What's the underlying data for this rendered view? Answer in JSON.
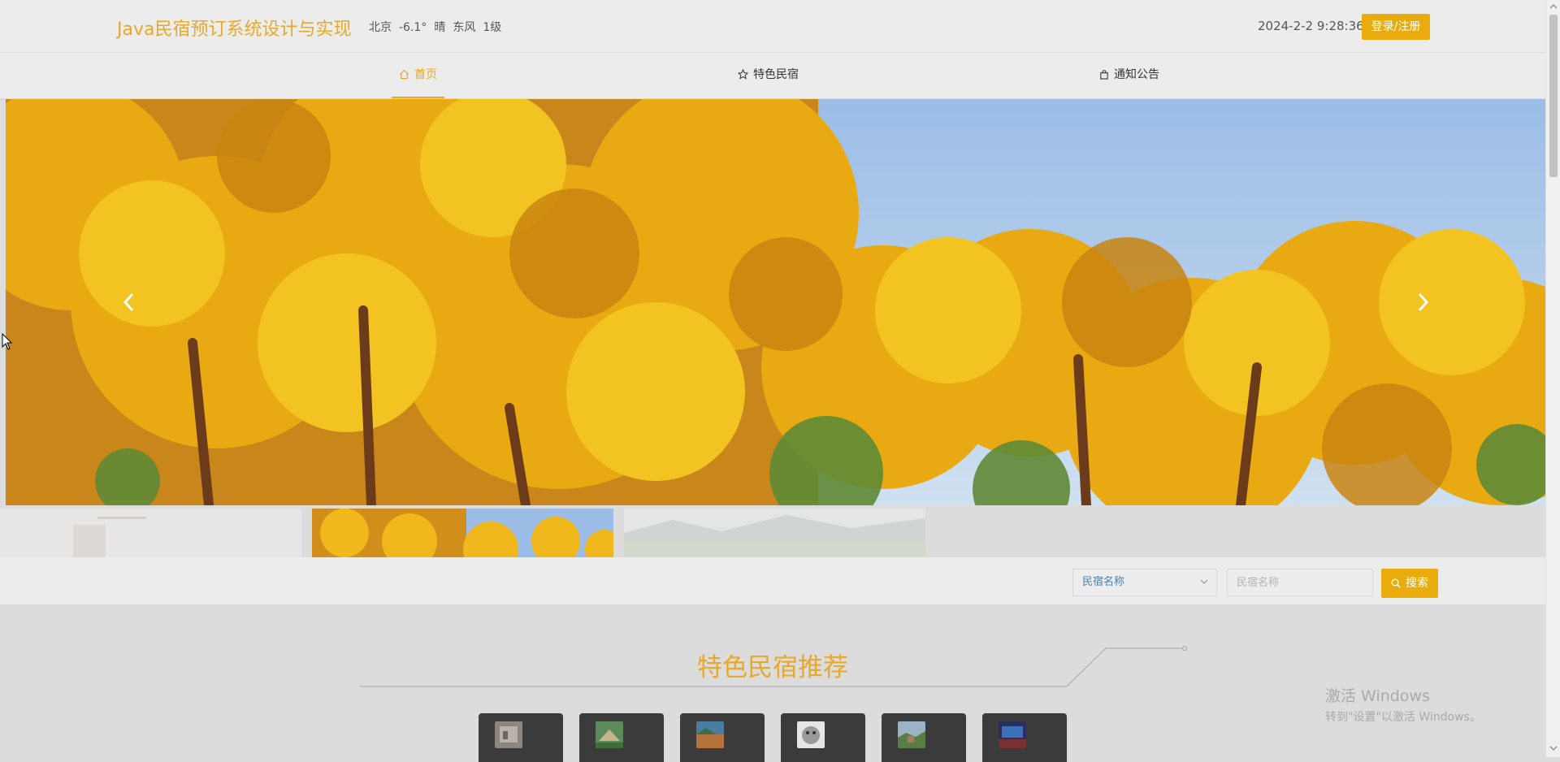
{
  "header": {
    "site_title": "Java民宿预订系统设计与实现",
    "weather": {
      "city": "北京",
      "temperature": "-6.1°",
      "condition": "晴",
      "wind": "东风",
      "level": "1级"
    },
    "datetime": "2024-2-2 9:28:36",
    "login_label": "登录/注册"
  },
  "nav": {
    "items": [
      {
        "label": "首页",
        "icon": "home-icon",
        "active": true
      },
      {
        "label": "特色民宿",
        "icon": "star-icon",
        "active": false
      },
      {
        "label": "通知公告",
        "icon": "bag-icon",
        "active": false
      }
    ]
  },
  "carousel": {
    "active_index": 1,
    "slide_count": 3,
    "prev_icon": "chevron-left-icon",
    "next_icon": "chevron-right-icon"
  },
  "search": {
    "field_selected": "民宿名称",
    "input_placeholder": "民宿名称",
    "button_label": "搜索"
  },
  "section": {
    "title": "特色民宿推荐"
  },
  "watermark": {
    "line1": "激活 Windows",
    "line2": "转到\"设置\"以激活 Windows。"
  },
  "colors": {
    "accent": "#e6a92a",
    "button": "#e9ac0c",
    "header_bg": "#ececec",
    "page_bg": "#dcdcdc",
    "card_bg": "#3b3b3b"
  }
}
